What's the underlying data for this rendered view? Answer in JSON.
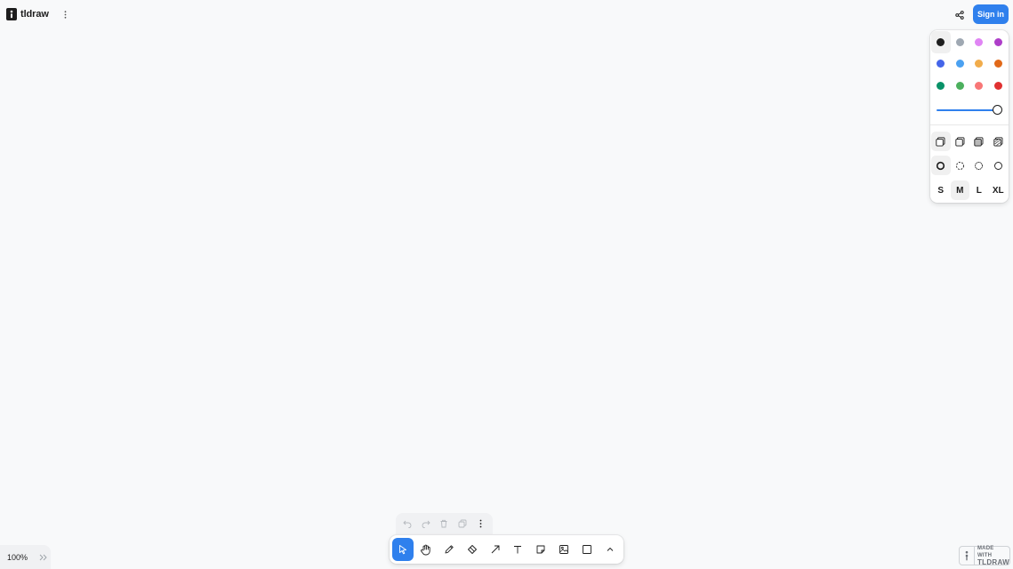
{
  "app": {
    "name": "tldraw"
  },
  "header": {
    "menu_icon": "vertical-dots-icon",
    "share_icon": "share-icon",
    "signin_label": "Sign in"
  },
  "style_panel": {
    "colors": [
      {
        "name": "black",
        "hex": "#1d1d1d",
        "selected": true
      },
      {
        "name": "grey",
        "hex": "#9fa8b2",
        "selected": false
      },
      {
        "name": "light-violet",
        "hex": "#e085f4",
        "selected": false
      },
      {
        "name": "violet",
        "hex": "#ae3ec9",
        "selected": false
      },
      {
        "name": "blue",
        "hex": "#4465e9",
        "selected": false
      },
      {
        "name": "light-blue",
        "hex": "#4ba1f1",
        "selected": false
      },
      {
        "name": "yellow",
        "hex": "#f1ac4b",
        "selected": false
      },
      {
        "name": "orange",
        "hex": "#e16919",
        "selected": false
      },
      {
        "name": "green",
        "hex": "#099268",
        "selected": false
      },
      {
        "name": "light-green",
        "hex": "#4cb05e",
        "selected": false
      },
      {
        "name": "light-red",
        "hex": "#f87777",
        "selected": false
      },
      {
        "name": "red",
        "hex": "#e03131",
        "selected": false
      }
    ],
    "opacity": 1.0,
    "fill_options": [
      {
        "name": "fill-none-icon",
        "selected": true
      },
      {
        "name": "fill-semi-icon",
        "selected": false
      },
      {
        "name": "fill-solid-icon",
        "selected": false
      },
      {
        "name": "fill-pattern-icon",
        "selected": false
      }
    ],
    "dash_options": [
      {
        "name": "dash-draw-icon",
        "selected": true
      },
      {
        "name": "dash-dashed-icon",
        "selected": false
      },
      {
        "name": "dash-dotted-icon",
        "selected": false
      },
      {
        "name": "dash-solid-icon",
        "selected": false
      }
    ],
    "sizes": [
      {
        "label": "S",
        "selected": false
      },
      {
        "label": "M",
        "selected": true
      },
      {
        "label": "L",
        "selected": false
      },
      {
        "label": "XL",
        "selected": false
      }
    ]
  },
  "zoom": {
    "label": "100%"
  },
  "action_bar": [
    "undo-icon",
    "redo-icon",
    "trash-icon",
    "duplicate-icon",
    "more-icon"
  ],
  "toolbar": {
    "tools": [
      "select-icon",
      "hand-icon",
      "pencil-icon",
      "eraser-icon",
      "arrow-icon",
      "text-icon",
      "note-icon",
      "image-icon",
      "rectangle-icon",
      "chevron-up-icon"
    ],
    "selected": "select-icon"
  },
  "watermark": {
    "line1": "MADE WITH",
    "line2": "TLDRAW"
  },
  "colors": {
    "accent": "#2f80ed",
    "canvas": "#f8f9fa"
  }
}
